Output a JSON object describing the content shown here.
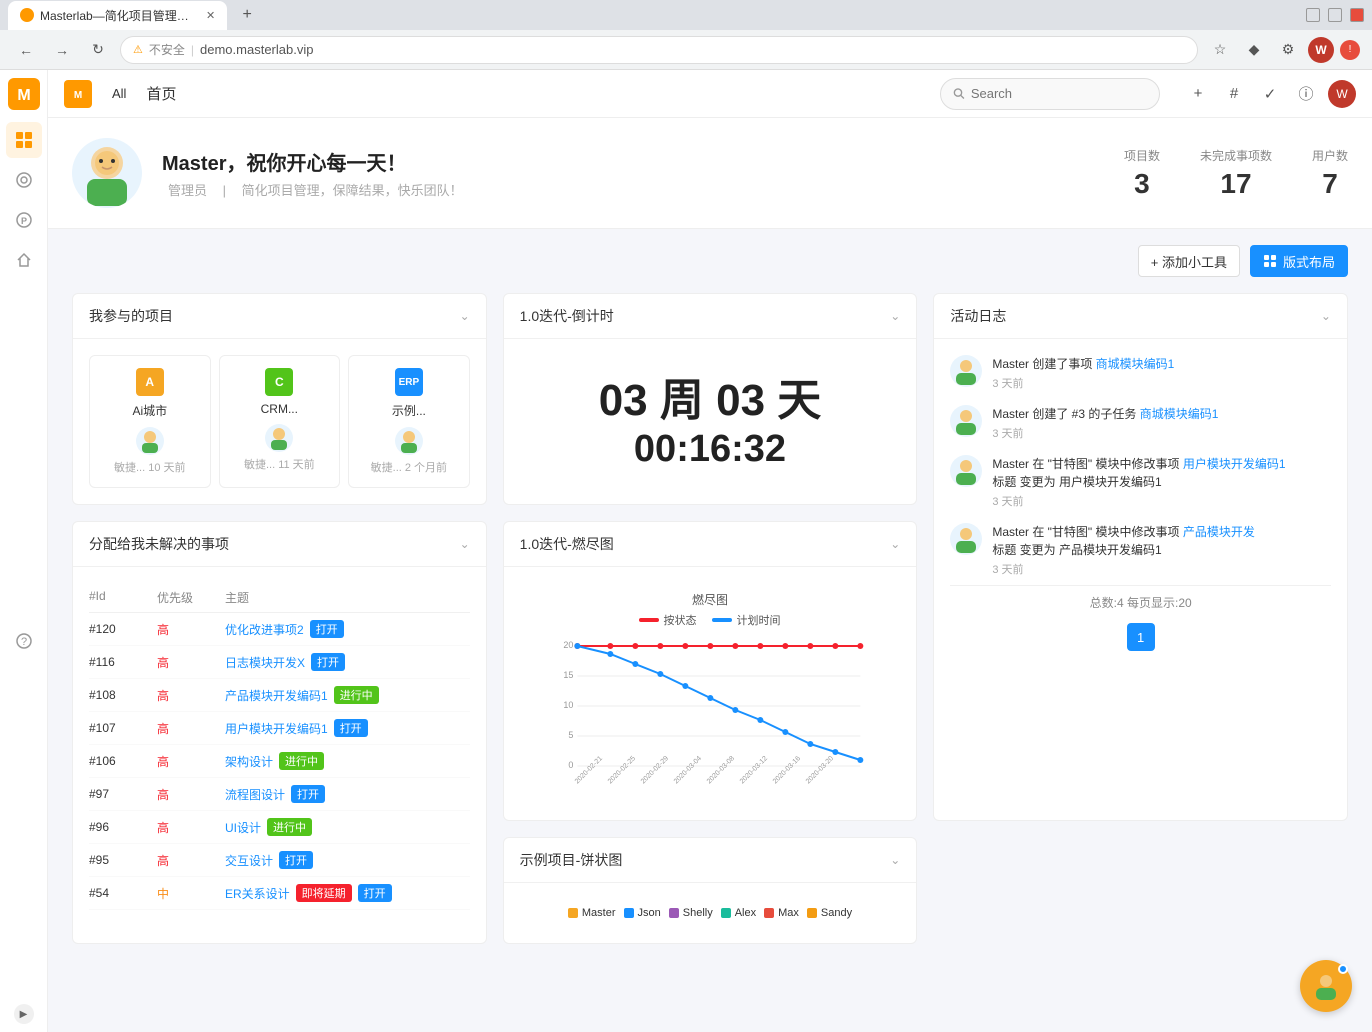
{
  "browser": {
    "tab_title": "Masterlab—简化项目管理的利器",
    "url": "demo.masterlab.vip",
    "url_protocol": "不安全"
  },
  "nav": {
    "all_label": "All",
    "home_label": "首页",
    "search_placeholder": "Search"
  },
  "profile": {
    "greeting": "Master，祝你开心每一天！",
    "role": "管理员",
    "desc": "简化项目管理，保障结果，快乐团队！",
    "stats": {
      "projects_label": "项目数",
      "projects_value": "3",
      "issues_label": "未完成事项数",
      "issues_value": "17",
      "users_label": "用户数",
      "users_value": "7"
    }
  },
  "toolbar": {
    "add_widget": "+ 添加小工具",
    "layout": "版式布局"
  },
  "widgets": {
    "my_projects": {
      "title": "我参与的项目",
      "projects": [
        {
          "name": "Ai城市",
          "abbr": "A",
          "color": "#f5a623",
          "time": "敏捷... 10 天前"
        },
        {
          "name": "CRM...",
          "abbr": "C",
          "color": "#52c41a",
          "time": "敏捷... 11 天前"
        },
        {
          "name": "示例...",
          "abbr": "ERP",
          "color": "#1890ff",
          "time": "敏捷... 2 个月前"
        }
      ]
    },
    "countdown": {
      "title": "1.0迭代-倒计时",
      "weeks": "03 周 03 天",
      "time": "00:16:32"
    },
    "activity": {
      "title": "活动日志",
      "items": [
        {
          "text": "Master 创建了事项 ",
          "link": "商城模块编码1",
          "time": "3 天前"
        },
        {
          "text": "Master 创建了 #3 的子任务 ",
          "link": "商城模块编码1",
          "time": "3 天前"
        },
        {
          "text_before": "Master 在 \"甘特图\" 模块中修改事项 ",
          "link": "用户模块开发编码1",
          "text_after": "\n标题 变更为 用户模块开发编码1",
          "time": "3 天前"
        },
        {
          "text_before": "Master 在 \"甘特图\" 模块中修改事项 ",
          "link": "产品模块开发",
          "text_after": "\n标题 变更为 产品模块开发编码1",
          "time": "3 天前"
        }
      ],
      "pagination_info": "总数:4 每页显示:20",
      "page": "1"
    },
    "issues": {
      "title": "分配给我未解决的事项",
      "headers": [
        "#Id",
        "优先级",
        "主题"
      ],
      "rows": [
        {
          "id": "#120",
          "priority": "高",
          "priority_level": "high",
          "subject": "优化改进事项2",
          "tag": "打开",
          "tag_type": "open"
        },
        {
          "id": "#116",
          "priority": "高",
          "priority_level": "high",
          "subject": "日志模块开发X",
          "tag": "打开",
          "tag_type": "open"
        },
        {
          "id": "#108",
          "priority": "高",
          "priority_level": "high",
          "subject": "产品模块开发编码1",
          "tag": "进行中",
          "tag_type": "inprogress"
        },
        {
          "id": "#107",
          "priority": "高",
          "priority_level": "high",
          "subject": "用户模块开发编码1",
          "tag": "打开",
          "tag_type": "open"
        },
        {
          "id": "#106",
          "priority": "高",
          "priority_level": "high",
          "subject": "架构设计",
          "tag": "进行中",
          "tag_type": "inprogress"
        },
        {
          "id": "#97",
          "priority": "高",
          "priority_level": "high",
          "subject": "流程图设计",
          "tag": "打开",
          "tag_type": "open"
        },
        {
          "id": "#96",
          "priority": "高",
          "priority_level": "high",
          "subject": "UI设计",
          "tag": "进行中",
          "tag_type": "inprogress"
        },
        {
          "id": "#95",
          "priority": "高",
          "priority_level": "high",
          "subject": "交互设计",
          "tag": "打开",
          "tag_type": "open"
        },
        {
          "id": "#54",
          "priority": "中",
          "priority_level": "medium",
          "subject": "ER关系设计",
          "tag": "即将延期",
          "tag_type": "overdue"
        }
      ]
    },
    "burndown": {
      "title": "1.0迭代-燃尽图",
      "chart_title": "燃尽图",
      "legend": [
        {
          "label": "按状态",
          "color": "#f5222d"
        },
        {
          "label": "计划时间",
          "color": "#1890ff"
        }
      ]
    },
    "pie": {
      "title": "示例项目-饼状图",
      "legend": [
        {
          "label": "Master",
          "color": "#f5a623"
        },
        {
          "label": "Json",
          "color": "#1890ff"
        },
        {
          "label": "Shelly",
          "color": "#9b59b6"
        },
        {
          "label": "Alex",
          "color": "#1abc9c"
        },
        {
          "label": "Max",
          "color": "#e74c3c"
        },
        {
          "label": "Sandy",
          "color": "#f39c12"
        }
      ]
    }
  }
}
